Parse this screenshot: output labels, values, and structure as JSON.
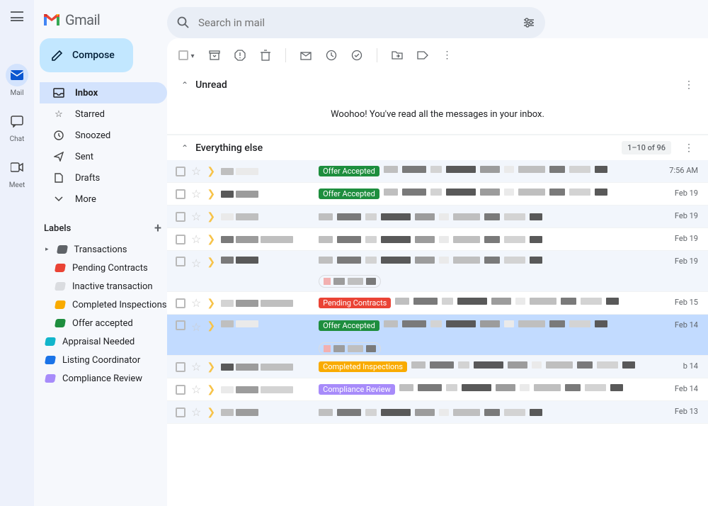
{
  "app": {
    "name": "Gmail"
  },
  "rail": {
    "mail": "Mail",
    "chat": "Chat",
    "meet": "Meet"
  },
  "search": {
    "placeholder": "Search in mail"
  },
  "sidebar": {
    "compose": "Compose",
    "nav": [
      {
        "label": "Inbox"
      },
      {
        "label": "Starred"
      },
      {
        "label": "Snoozed"
      },
      {
        "label": "Sent"
      },
      {
        "label": "Drafts"
      },
      {
        "label": "More"
      }
    ],
    "labels_header": "Labels",
    "labels": [
      {
        "label": "Transactions",
        "color": "#5f6368",
        "sub": false
      },
      {
        "label": "Pending Contracts",
        "color": "#ea4335",
        "sub": true
      },
      {
        "label": "Inactive transaction",
        "color": "#dadce0",
        "sub": true
      },
      {
        "label": "Completed Inspections",
        "color": "#f9ab00",
        "sub": true
      },
      {
        "label": "Offer accepted",
        "color": "#1e8e3e",
        "sub": true
      },
      {
        "label": "Appraisal Needed",
        "color": "#12b5cb",
        "sub": false
      },
      {
        "label": "Listing Coordinator",
        "color": "#1a73e8",
        "sub": false
      },
      {
        "label": "Compliance Review",
        "color": "#a78bfa",
        "sub": false
      }
    ]
  },
  "sections": {
    "unread": {
      "title": "Unread",
      "empty": "Woohoo! You've read all the messages in your inbox."
    },
    "else": {
      "title": "Everything else",
      "counter": "1–10 of 96"
    }
  },
  "pills": {
    "offerAccepted": {
      "text": "Offer Accepted",
      "color": "#1e8e3e"
    },
    "pendingContracts": {
      "text": "Pending Contracts",
      "color": "#ea4335"
    },
    "completedInspections": {
      "text": "Completed Inspections",
      "color": "#f9ab00"
    },
    "complianceReview": {
      "text": "Compliance Review",
      "color": "#a78bfa"
    }
  },
  "emails": [
    {
      "pill": "offerAccepted",
      "time": "7:56 AM",
      "attach": false,
      "selected": false,
      "shaded": true
    },
    {
      "pill": "offerAccepted",
      "time": "Feb 19",
      "attach": false,
      "selected": false,
      "shaded": false
    },
    {
      "pill": null,
      "time": "Feb 19",
      "attach": false,
      "selected": false,
      "shaded": true
    },
    {
      "pill": null,
      "time": "Feb 19",
      "attach": false,
      "selected": false,
      "shaded": false
    },
    {
      "pill": null,
      "time": "Feb 19",
      "attach": true,
      "selected": false,
      "shaded": true
    },
    {
      "pill": "pendingContracts",
      "time": "Feb 15",
      "attach": false,
      "selected": false,
      "shaded": false
    },
    {
      "pill": "offerAccepted",
      "time": "Feb 14",
      "attach": true,
      "selected": true,
      "shaded": false
    },
    {
      "pill": "completedInspections",
      "time": "b 14",
      "attach": false,
      "selected": false,
      "shaded": true
    },
    {
      "pill": "complianceReview",
      "time": "Feb 14",
      "attach": false,
      "selected": false,
      "shaded": false
    },
    {
      "pill": null,
      "time": "Feb 13",
      "attach": false,
      "selected": false,
      "shaded": true
    }
  ]
}
